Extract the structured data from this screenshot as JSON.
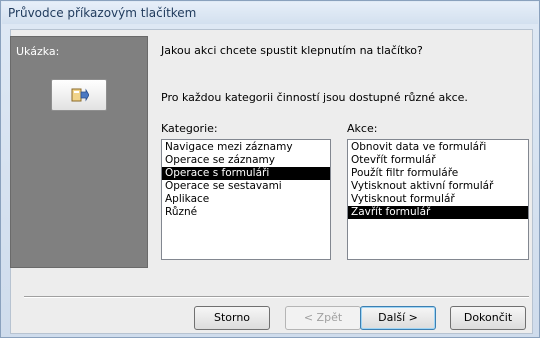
{
  "window": {
    "title": "Průvodce příkazovým tlačítkem"
  },
  "preview": {
    "label": "Ukázka:",
    "button_icon": "form-close-icon"
  },
  "question": "Jakou akci chcete spustit klepnutím na tlačítko?",
  "info": "Pro každou kategorii činností jsou dostupné různé akce.",
  "categories": {
    "label": "Kategorie:",
    "items": [
      {
        "label": "Navigace mezi záznamy",
        "selected": false
      },
      {
        "label": "Operace se záznamy",
        "selected": false
      },
      {
        "label": "Operace s formuláři",
        "selected": true
      },
      {
        "label": "Operace se sestavami",
        "selected": false
      },
      {
        "label": "Aplikace",
        "selected": false
      },
      {
        "label": "Různé",
        "selected": false
      }
    ]
  },
  "actions": {
    "label": "Akce:",
    "items": [
      {
        "label": "Obnovit data ve formuláři",
        "selected": false
      },
      {
        "label": "Otevřít formulář",
        "selected": false
      },
      {
        "label": "Použít filtr formuláře",
        "selected": false
      },
      {
        "label": "Vytisknout aktivní formulář",
        "selected": false
      },
      {
        "label": "Vytisknout formulář",
        "selected": false
      },
      {
        "label": "Zavřít formulář",
        "selected": true
      }
    ]
  },
  "buttons": {
    "cancel": "Storno",
    "back": "< Zpět",
    "next": "Další >",
    "finish": "Dokončit"
  },
  "colors": {
    "selection": "#000000",
    "preview_panel": "#808080",
    "title_text": "#1f3a5c"
  }
}
